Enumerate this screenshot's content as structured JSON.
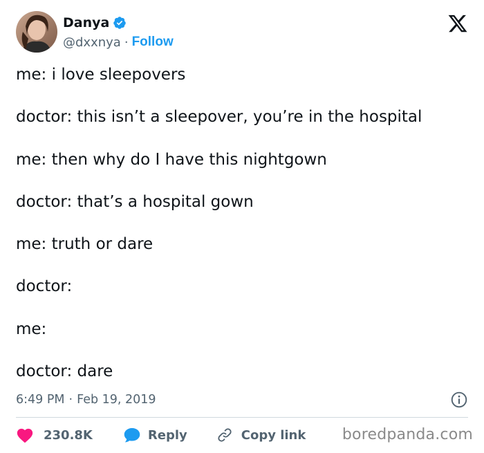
{
  "author": {
    "display_name": "Danya",
    "handle": "@dxxnya",
    "separator": "·",
    "follow_label": "Follow"
  },
  "tweet": {
    "lines": [
      "me: i love sleepovers",
      "doctor: this isn’t a sleepover, you’re in the hospital",
      "me: then why do I have this nightgown",
      "doctor: that’s a hospital gown",
      "me: truth or dare",
      "doctor:",
      "me:",
      "doctor: dare"
    ],
    "time": "6:49 PM",
    "separator": "·",
    "date": "Feb 19, 2019"
  },
  "actions": {
    "like_count": "230.8K",
    "reply_label": "Reply",
    "copy_link_label": "Copy link"
  },
  "watermark": "boredpanda.com",
  "colors": {
    "accent_blue": "#1d9bf0",
    "like_red": "#f91880",
    "text_primary": "#0f1419",
    "text_secondary": "#536471",
    "divider": "#cfd9de"
  },
  "icons": {
    "verified": "verified-badge-icon",
    "brand": "x-logo-icon",
    "info": "info-icon",
    "like": "heart-icon",
    "reply": "speech-bubble-icon",
    "copy": "link-icon"
  }
}
